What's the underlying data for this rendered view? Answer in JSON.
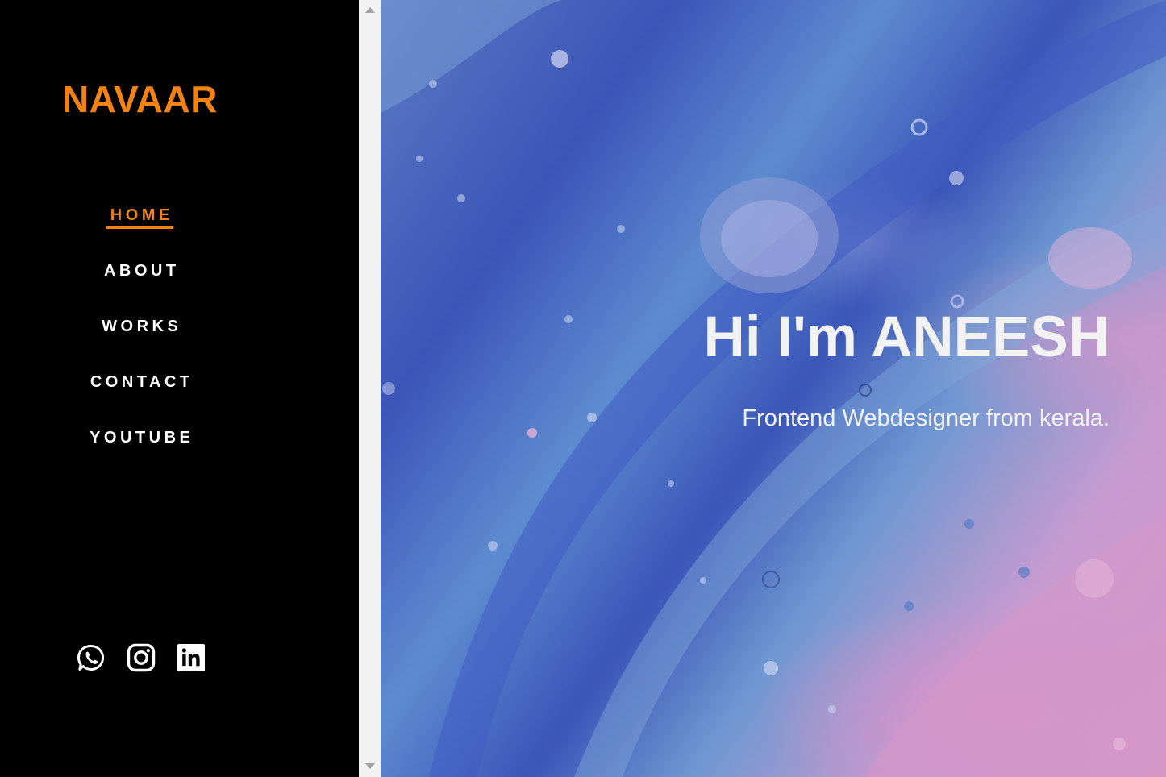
{
  "brand": {
    "logo": "NAVAAR",
    "accent_color": "#f28213"
  },
  "nav": {
    "items": [
      {
        "label": "HOME",
        "active": true
      },
      {
        "label": "ABOUT",
        "active": false
      },
      {
        "label": "WORKS",
        "active": false
      },
      {
        "label": "CONTACT",
        "active": false
      },
      {
        "label": "YOUTUBE",
        "active": false
      }
    ]
  },
  "social": {
    "icons": [
      "whatsapp-icon",
      "instagram-icon",
      "linkedin-icon"
    ]
  },
  "hero": {
    "title": "Hi I'm ANEESH",
    "subtitle": "Frontend Webdesigner from kerala."
  }
}
